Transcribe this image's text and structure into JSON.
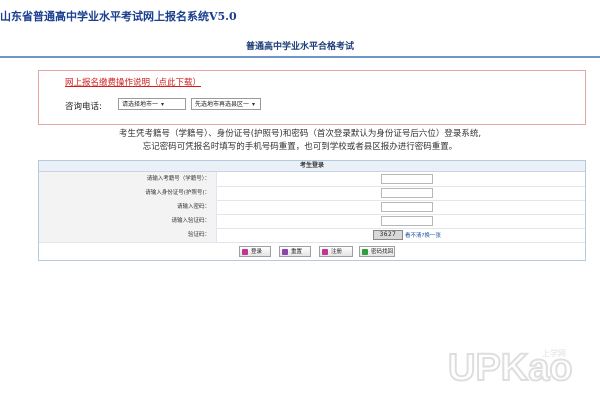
{
  "header": {
    "system_title": "山东省普通高中学业水平考试网上报名系统V5.0",
    "page_subtitle": "普通高中学业水平合格考试"
  },
  "notice": {
    "link_text": "网上报名缴费操作说明（点此下载）",
    "phone_label": "咨询电话:",
    "select_city": "请选择地市一",
    "select_district": "先选地市再选县区一"
  },
  "instructions": {
    "line1": "考生凭考籍号（学籍号）、身份证号(护照号)和密码（首次登录默认为身份证号后六位）登录系统,",
    "line2": "忘记密码可凭报名时填写的手机号码重置，也可到学校或者县区报办进行密码重置。"
  },
  "login": {
    "header": "考生登录",
    "fields": [
      {
        "label": "请输入考籍号（学籍号）：",
        "value": ""
      },
      {
        "label": "请输入身份证号(护照号)：",
        "value": ""
      },
      {
        "label": "请输入密码：",
        "value": ""
      },
      {
        "label": "请输入验证码：",
        "value": ""
      }
    ],
    "captcha_label": "验证码：",
    "captcha_text": "3627",
    "captcha_refresh": "看不清?换一张",
    "buttons": [
      {
        "label": "登录",
        "color": "#c2368f"
      },
      {
        "label": "重置",
        "color": "#8e44ad"
      },
      {
        "label": "注册",
        "color": "#c2368f"
      },
      {
        "label": "密码找回",
        "color": "#2f9e3c"
      }
    ]
  },
  "watermark": {
    "text": "UPKao",
    "subtext": "上学网"
  }
}
